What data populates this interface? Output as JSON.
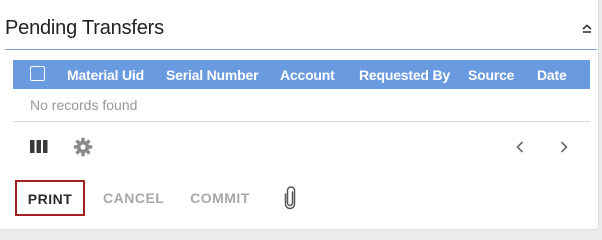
{
  "panel": {
    "title": "Pending Transfers"
  },
  "grid": {
    "columns": [
      "Material Uid",
      "Serial Number",
      "Account",
      "Requested By",
      "Source",
      "Date"
    ],
    "empty_message": "No records found"
  },
  "actions": {
    "print_label": "PRINT",
    "cancel_label": "CANCEL",
    "commit_label": "COMMIT"
  },
  "icons": {
    "collapse": "chevron-up-icon",
    "columns": "columns-icon",
    "settings": "gear-icon",
    "prev_page": "chevron-left-icon",
    "next_page": "chevron-right-icon",
    "attach": "paperclip-icon"
  },
  "colors": {
    "header_accent": "#7fa4d6",
    "grid_header": "#6a9ae0",
    "print_border": "#a52020",
    "disabled_text": "#a8a8a8"
  }
}
